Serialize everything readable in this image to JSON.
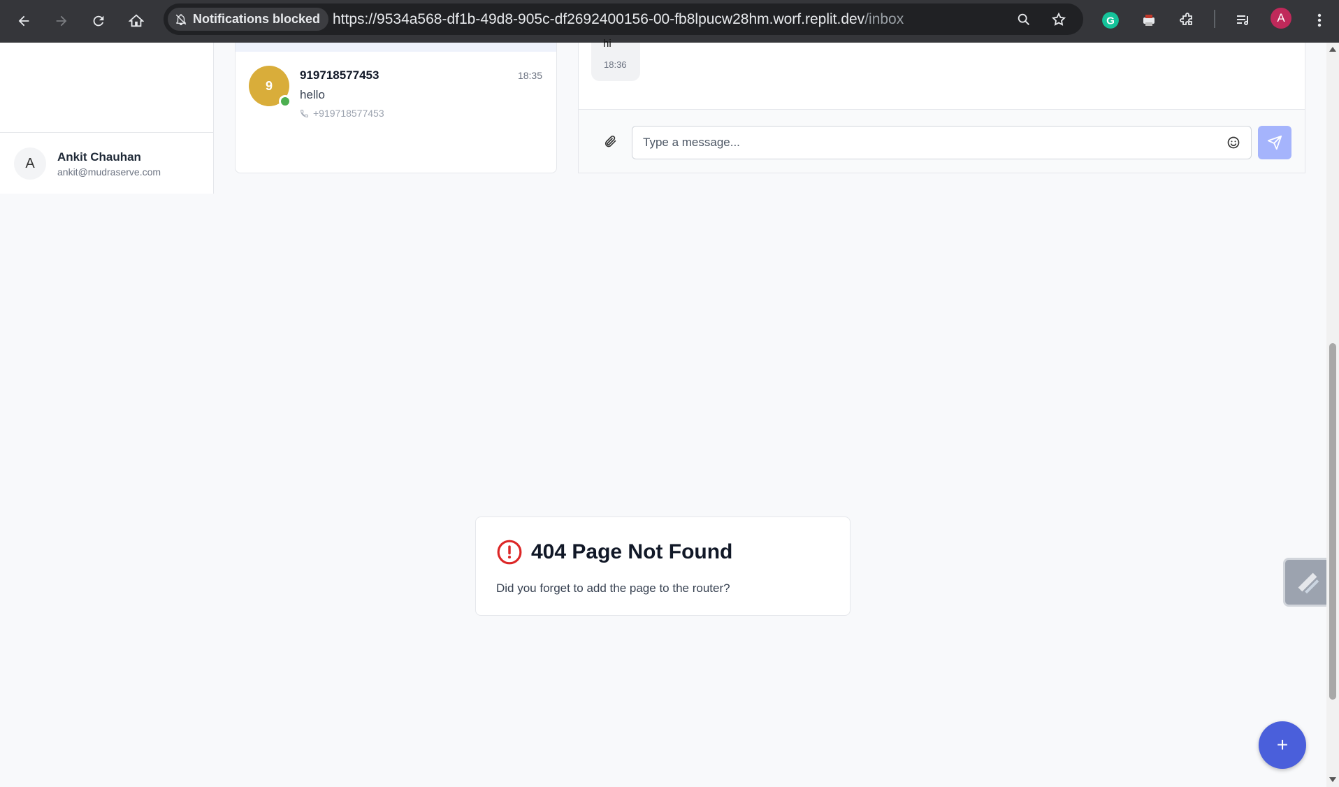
{
  "browser": {
    "notification_chip": "Notifications blocked",
    "url_main": "https://9534a568-df1b-49d8-905c-df2692400156-00-fb8lpucw28hm.worf.replit.dev",
    "url_path": "/inbox",
    "profile_initial": "A"
  },
  "sidebar": {
    "user": {
      "initial": "A",
      "name": "Ankit Chauhan",
      "email": "ankit@mudraserve.com"
    }
  },
  "conversations": [
    {
      "avatar_initial": "9",
      "name": "919718577453",
      "time": "18:35",
      "last_message": "hello",
      "phone": "+919718577453",
      "online": true
    }
  ],
  "chat": {
    "message": {
      "text": "hi",
      "time": "18:36"
    },
    "composer": {
      "placeholder": "Type a message..."
    }
  },
  "not_found": {
    "title": "404 Page Not Found",
    "description": "Did you forget to add the page to the router?"
  },
  "fab": {
    "label": "+"
  },
  "colors": {
    "accent": "#4a5fdb",
    "send_disabled": "#a5b4fc",
    "avatar_yellow": "#d9ad3a",
    "online_green": "#4caf50",
    "error_red": "#dc2626"
  }
}
